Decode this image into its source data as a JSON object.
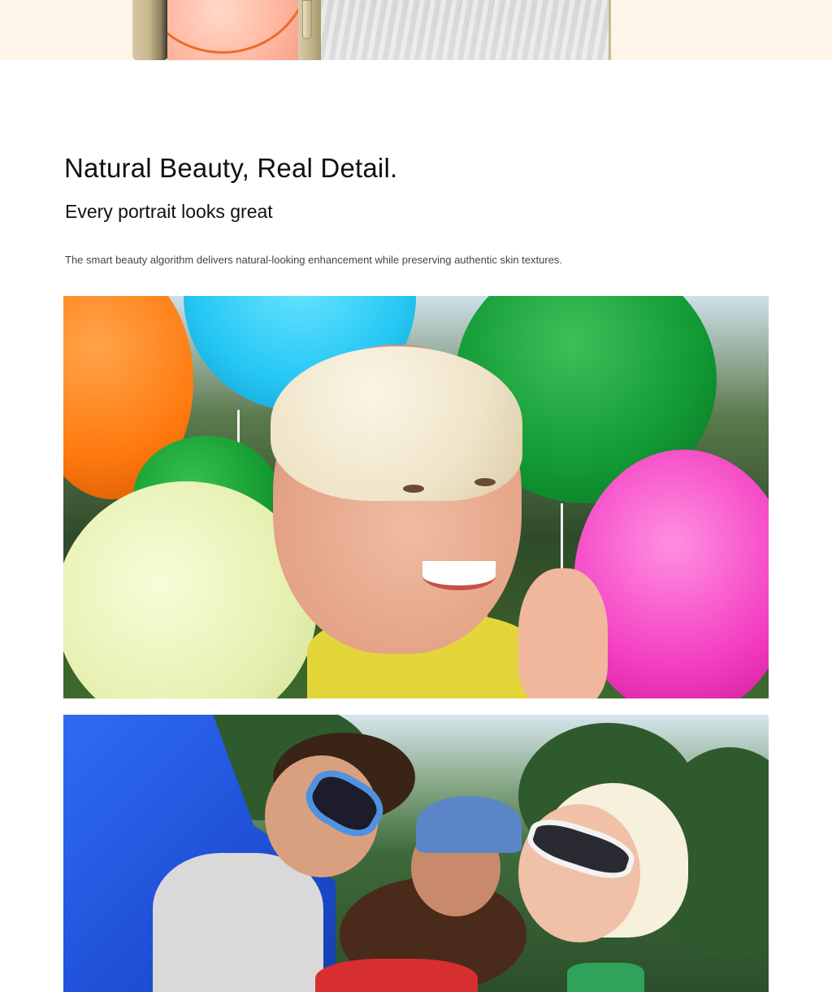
{
  "hero": {
    "headline": "Natural Beauty, Real Detail.",
    "subheadline": "Every portrait looks great",
    "description": "The smart beauty algorithm delivers natural-looking enhancement while preserving authentic skin textures."
  },
  "colors": {
    "banner_background": "#fdf5e8",
    "page_background": "#ffffff",
    "heading_text": "#111111",
    "body_text": "#444444"
  }
}
